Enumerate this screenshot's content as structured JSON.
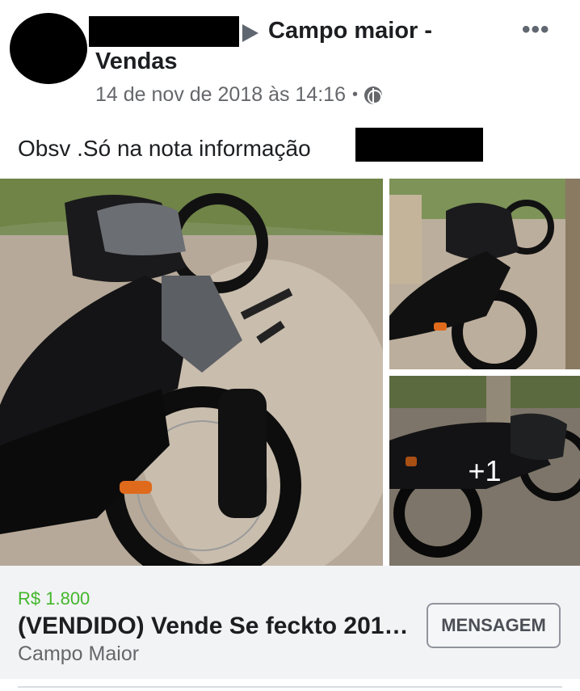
{
  "post": {
    "group_name_line1": "Campo maior -",
    "group_name_line2": "Vendas",
    "date": "14 de nov de 2018 às 14:16",
    "separator": "•",
    "privacy_icon": "globe-icon",
    "more_icon": "•••",
    "text": "Obsv .Só na nota informação"
  },
  "photos": {
    "more_count": "+1"
  },
  "listing": {
    "price": "R$ 1.800",
    "title": "(VENDIDO) Vende Se feckto 201…",
    "location": "Campo Maior",
    "message_button": "MENSAGEM"
  },
  "colors": {
    "price_green": "#42b72a",
    "listing_bg": "#f2f3f5",
    "text_primary": "#1c1e21",
    "text_secondary": "#65676b"
  }
}
